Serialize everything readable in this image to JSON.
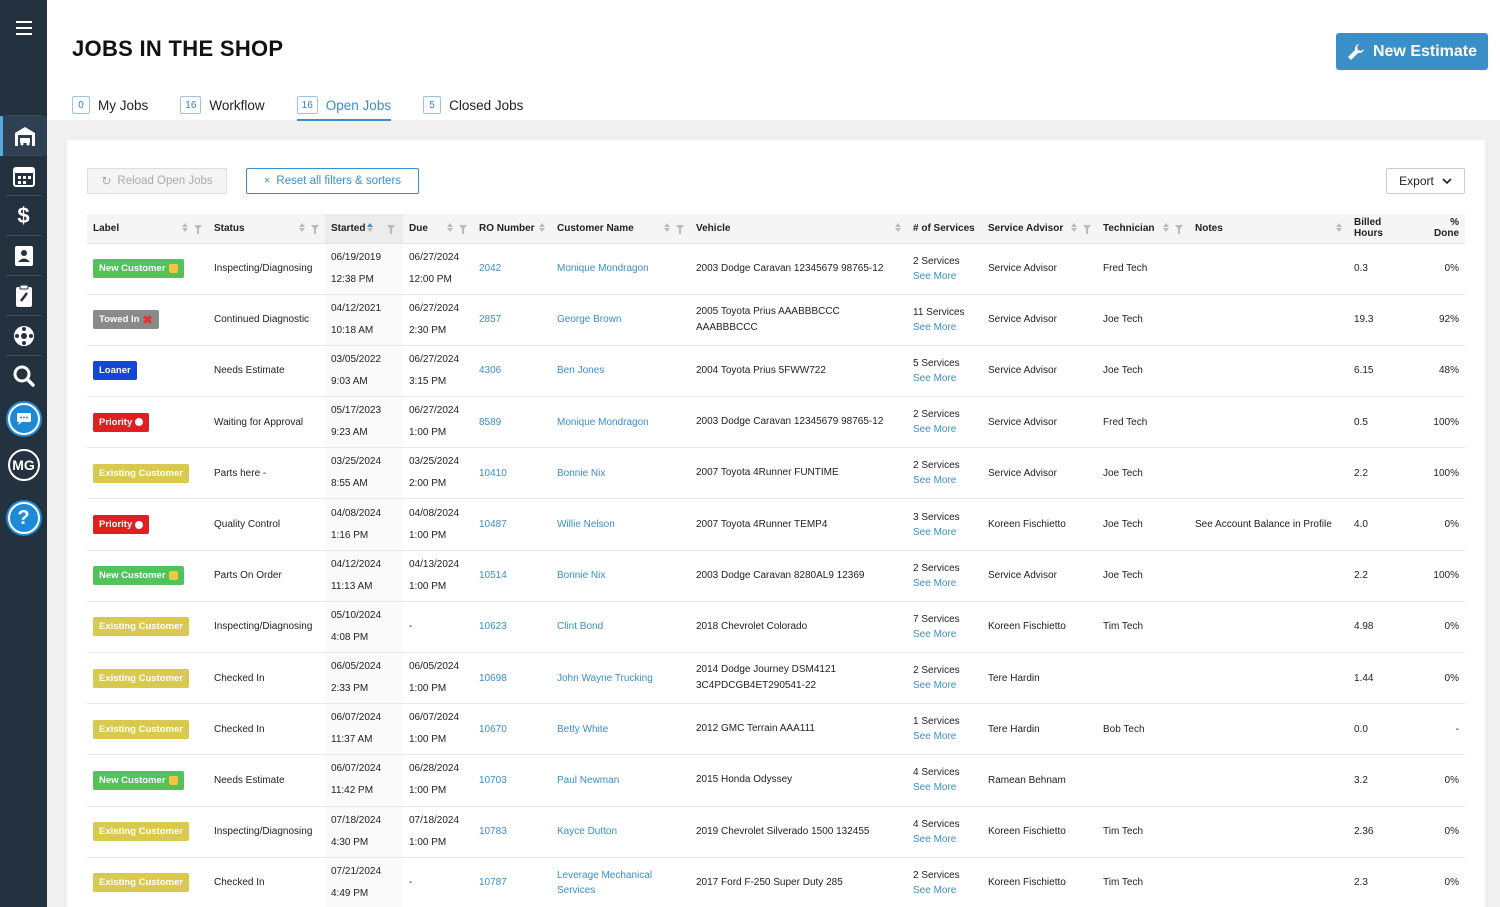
{
  "page": {
    "title": "JOBS IN THE SHOP",
    "new_estimate_label": "New Estimate"
  },
  "tabs": [
    {
      "count": "0",
      "label": "My Jobs"
    },
    {
      "count": "16",
      "label": "Workflow"
    },
    {
      "count": "16",
      "label": "Open Jobs"
    },
    {
      "count": "5",
      "label": "Closed Jobs"
    }
  ],
  "sidebar": {
    "user_initials": "MG"
  },
  "toolbar": {
    "reload_label": "Reload Open Jobs",
    "reset_label": "Reset all filters & sorters",
    "export_label": "Export"
  },
  "columns": [
    "Label",
    "Status",
    "Started",
    "Due",
    "RO Number",
    "Customer Name",
    "Vehicle",
    "# of Services",
    "Service Advisor",
    "Technician",
    "Notes",
    "Billed Hours",
    "% Done"
  ],
  "badges": {
    "new": "New Customer",
    "tow": "Towed In",
    "loan": "Loaner",
    "pri": "Priority",
    "ex": "Existing Customer"
  },
  "see_more": "See More",
  "rows": [
    {
      "label": "new",
      "status": "Inspecting/Diagnosing",
      "started_d": "06/19/2019",
      "started_t": "12:38 PM",
      "due_d": "06/27/2024",
      "due_t": "12:00 PM",
      "ro": "2042",
      "customer": "Monique Mondragon",
      "vehicle": "2003 Dodge Caravan 12345679 98765-12",
      "services": "2 Services",
      "advisor": "Service Advisor",
      "tech": "Fred Tech",
      "notes": "",
      "hours": "0.3",
      "done": "0%"
    },
    {
      "label": "tow",
      "status": "Continued Diagnostic",
      "started_d": "04/12/2021",
      "started_t": "10:18 AM",
      "due_d": "06/27/2024",
      "due_t": "2:30 PM",
      "ro": "2857",
      "customer": "George Brown",
      "vehicle": "2005 Toyota Prius AAABBBCCC AAABBBCCC",
      "services": "11 Services",
      "advisor": "Service Advisor",
      "tech": "Joe Tech",
      "notes": "",
      "hours": "19.3",
      "done": "92%"
    },
    {
      "label": "loan",
      "status": "Needs Estimate",
      "started_d": "03/05/2022",
      "started_t": "9:03 AM",
      "due_d": "06/27/2024",
      "due_t": "3:15 PM",
      "ro": "4306",
      "customer": "Ben Jones",
      "vehicle": "2004 Toyota Prius 5FWW722",
      "services": "5 Services",
      "advisor": "Service Advisor",
      "tech": "Joe Tech",
      "notes": "",
      "hours": "6.15",
      "done": "48%"
    },
    {
      "label": "pri",
      "status": "Waiting for Approval",
      "started_d": "05/17/2023",
      "started_t": "9:23 AM",
      "due_d": "06/27/2024",
      "due_t": "1:00 PM",
      "ro": "8589",
      "customer": "Monique Mondragon",
      "vehicle": "2003 Dodge Caravan 12345679 98765-12",
      "services": "2 Services",
      "advisor": "Service Advisor",
      "tech": "Fred Tech",
      "notes": "",
      "hours": "0.5",
      "done": "100%"
    },
    {
      "label": "ex",
      "status": "Parts here -",
      "started_d": "03/25/2024",
      "started_t": "8:55 AM",
      "due_d": "03/25/2024",
      "due_t": "2:00 PM",
      "ro": "10410",
      "customer": "Bonnie Nix",
      "vehicle": "2007 Toyota 4Runner FUNTIME",
      "services": "2 Services",
      "advisor": "Service Advisor",
      "tech": "Joe Tech",
      "notes": "",
      "hours": "2.2",
      "done": "100%"
    },
    {
      "label": "pri",
      "status": "Quality Control",
      "started_d": "04/08/2024",
      "started_t": "1:16 PM",
      "due_d": "04/08/2024",
      "due_t": "1:00 PM",
      "ro": "10487",
      "customer": "Willie Nelson",
      "vehicle": "2007 Toyota 4Runner TEMP4",
      "services": "3 Services",
      "advisor": "Koreen Fischietto",
      "tech": "Joe Tech",
      "notes": "See Account Balance in Profile",
      "hours": "4.0",
      "done": "0%"
    },
    {
      "label": "new",
      "status": "Parts On Order",
      "started_d": "04/12/2024",
      "started_t": "11:13 AM",
      "due_d": "04/13/2024",
      "due_t": "1:00 PM",
      "ro": "10514",
      "customer": "Bonnie Nix",
      "vehicle": "2003 Dodge Caravan 8280AL9 12369",
      "services": "2 Services",
      "advisor": "Service Advisor",
      "tech": "Joe Tech",
      "notes": "",
      "hours": "2.2",
      "done": "100%"
    },
    {
      "label": "ex",
      "status": "Inspecting/Diagnosing",
      "started_d": "05/10/2024",
      "started_t": "4:08 PM",
      "due_d": "-",
      "due_t": "",
      "ro": "10623",
      "customer": "Clint Bond",
      "vehicle": "2018 Chevrolet Colorado",
      "services": "7 Services",
      "advisor": "Koreen Fischietto",
      "tech": "Tim Tech",
      "notes": "",
      "hours": "4.98",
      "done": "0%"
    },
    {
      "label": "ex",
      "status": "Checked In",
      "started_d": "06/05/2024",
      "started_t": "2:33 PM",
      "due_d": "06/05/2024",
      "due_t": "1:00 PM",
      "ro": "10698",
      "customer": "John Wayne Trucking",
      "vehicle": "2014 Dodge Journey DSM4121 3C4PDCGB4ET290541-22",
      "services": "2 Services",
      "advisor": "Tere Hardin",
      "tech": "",
      "notes": "",
      "hours": "1.44",
      "done": "0%"
    },
    {
      "label": "ex",
      "status": "Checked In",
      "started_d": "06/07/2024",
      "started_t": "11:37 AM",
      "due_d": "06/07/2024",
      "due_t": "1:00 PM",
      "ro": "10670",
      "customer": "Betty White",
      "vehicle": "2012 GMC Terrain AAA111",
      "services": "1 Services",
      "advisor": "Tere Hardin",
      "tech": "Bob Tech",
      "notes": "",
      "hours": "0.0",
      "done": "-"
    },
    {
      "label": "new",
      "status": "Needs Estimate",
      "started_d": "06/07/2024",
      "started_t": "11:42 PM",
      "due_d": "06/28/2024",
      "due_t": "1:00 PM",
      "ro": "10703",
      "customer": "Paul Newman",
      "vehicle": "2015 Honda Odyssey",
      "services": "4 Services",
      "advisor": "Ramean Behnam",
      "tech": "",
      "notes": "",
      "hours": "3.2",
      "done": "0%"
    },
    {
      "label": "ex",
      "status": "Inspecting/Diagnosing",
      "started_d": "07/18/2024",
      "started_t": "4:30 PM",
      "due_d": "07/18/2024",
      "due_t": "1:00 PM",
      "ro": "10783",
      "customer": "Kayce Dutton",
      "vehicle": "2019 Chevrolet Silverado 1500 132455",
      "services": "4 Services",
      "advisor": "Koreen Fischietto",
      "tech": "Tim Tech",
      "notes": "",
      "hours": "2.36",
      "done": "0%"
    },
    {
      "label": "ex",
      "status": "Checked In",
      "started_d": "07/21/2024",
      "started_t": "4:49 PM",
      "due_d": "-",
      "due_t": "",
      "ro": "10787",
      "customer": "Leverage Mechanical Services",
      "vehicle": "2017 Ford F-250 Super Duty 285",
      "services": "2 Services",
      "advisor": "Koreen Fischietto",
      "tech": "Tim Tech",
      "notes": "",
      "hours": "2.3",
      "done": "0%"
    }
  ]
}
